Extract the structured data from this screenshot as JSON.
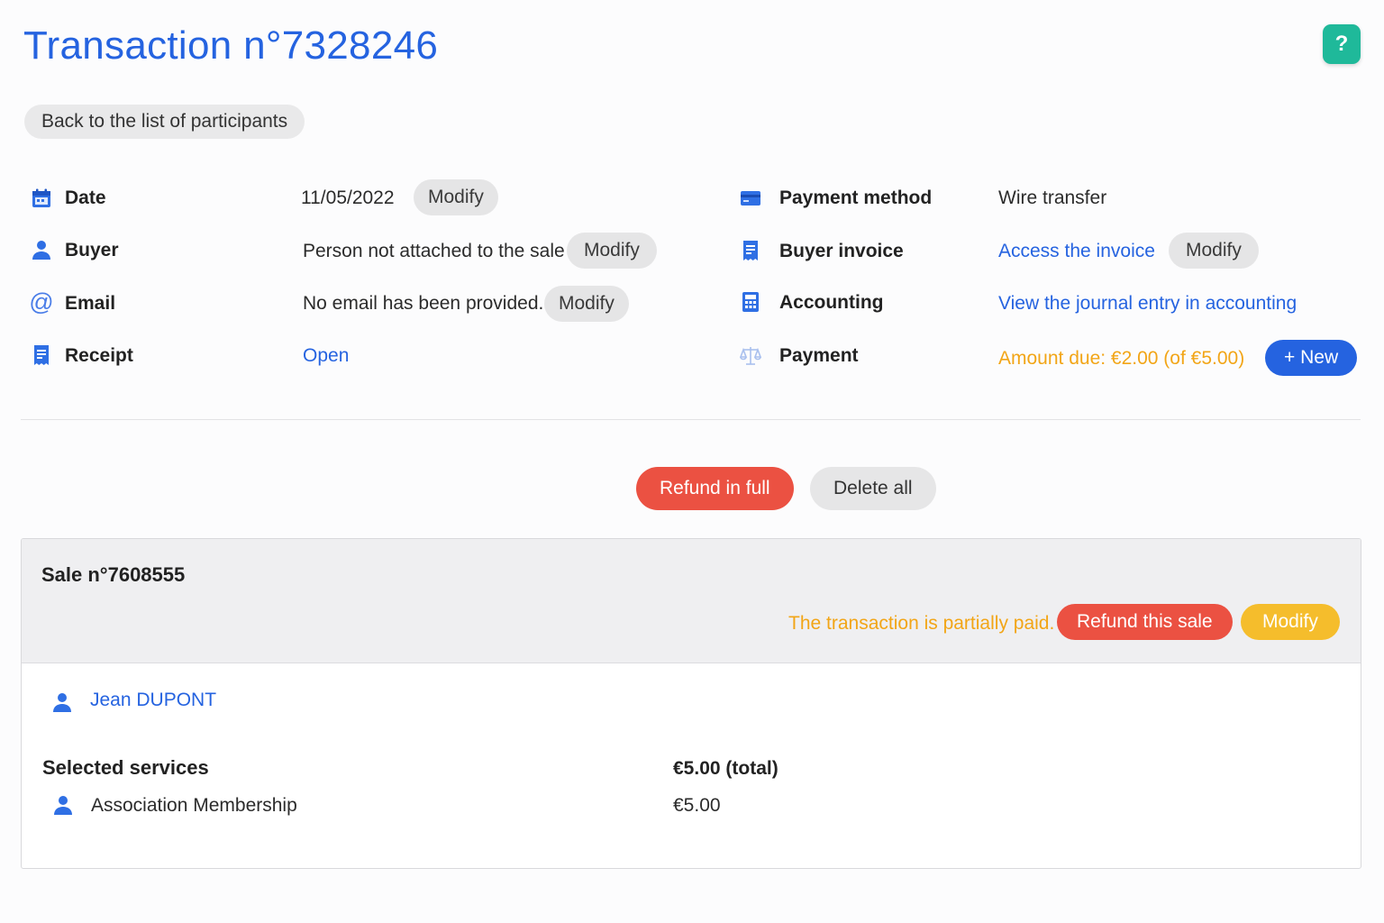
{
  "header": {
    "title": "Transaction n°7328246",
    "help_label": "?",
    "back_label": "Back to the list of participants"
  },
  "details_left": {
    "date_label": "Date",
    "date_value": "11/05/2022",
    "buyer_label": "Buyer",
    "buyer_value": "Person not attached to the sale",
    "email_label": "Email",
    "email_value": "No email has been provided.",
    "receipt_label": "Receipt",
    "receipt_link": "Open",
    "modify_label": "Modify"
  },
  "details_right": {
    "payment_method_label": "Payment method",
    "payment_method_value": "Wire transfer",
    "buyer_invoice_label": "Buyer invoice",
    "buyer_invoice_link": "Access the invoice",
    "accounting_label": "Accounting",
    "accounting_link": "View the journal entry in accounting",
    "payment_label": "Payment",
    "payment_status": "Amount due: €2.00 (of €5.00)",
    "new_button": "+ New",
    "modify_label": "Modify"
  },
  "actions": {
    "refund_full": "Refund in full",
    "delete_all": "Delete all"
  },
  "sale": {
    "title": "Sale n°7608555",
    "status": "The transaction is partially paid.",
    "refund_label": "Refund this sale",
    "modify_label": "Modify",
    "participant": "Jean DUPONT",
    "services_header": "Selected services",
    "total": "€5.00 (total)",
    "items": [
      {
        "name": "Association Membership",
        "price": "€5.00"
      }
    ]
  },
  "colors": {
    "primary": "#2563e0",
    "help": "#1fb99a",
    "danger": "#eb5142",
    "warning": "#f2a516",
    "modify_yellow": "#f5bd2c"
  }
}
